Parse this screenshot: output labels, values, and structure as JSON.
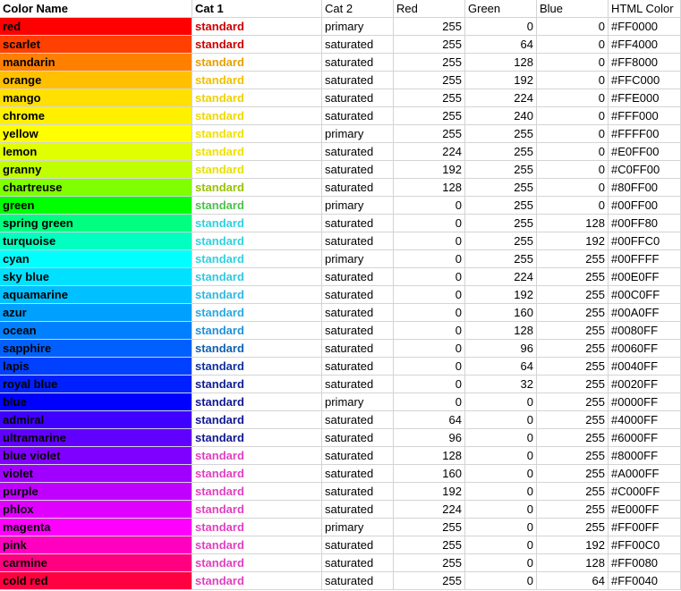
{
  "headers": [
    "Color Name",
    "Cat 1",
    "Cat 2",
    "Red",
    "Green",
    "Blue",
    "HTML Color"
  ],
  "rows": [
    {
      "name": "red",
      "cat1": "standard",
      "cat2": "primary",
      "r": 255,
      "g": 0,
      "b": 0,
      "hex": "#FF0000",
      "swatch": "#FF0000",
      "cat1_color": "#CC0000"
    },
    {
      "name": "scarlet",
      "cat1": "standard",
      "cat2": "saturated",
      "r": 255,
      "g": 64,
      "b": 0,
      "hex": "#FF4000",
      "swatch": "#FF4000",
      "cat1_color": "#CC0000"
    },
    {
      "name": "mandarin",
      "cat1": "standard",
      "cat2": "saturated",
      "r": 255,
      "g": 128,
      "b": 0,
      "hex": "#FF8000",
      "swatch": "#FF8000",
      "cat1_color": "#E6A000"
    },
    {
      "name": "orange",
      "cat1": "standard",
      "cat2": "saturated",
      "r": 255,
      "g": 192,
      "b": 0,
      "hex": "#FFC000",
      "swatch": "#FFC000",
      "cat1_color": "#F0C000"
    },
    {
      "name": "mango",
      "cat1": "standard",
      "cat2": "saturated",
      "r": 255,
      "g": 224,
      "b": 0,
      "hex": "#FFE000",
      "swatch": "#FFE000",
      "cat1_color": "#F0D000"
    },
    {
      "name": "chrome",
      "cat1": "standard",
      "cat2": "saturated",
      "r": 255,
      "g": 240,
      "b": 0,
      "hex": "#FFF000",
      "swatch": "#FFF000",
      "cat1_color": "#F0D800"
    },
    {
      "name": "yellow",
      "cat1": "standard",
      "cat2": "primary",
      "r": 255,
      "g": 255,
      "b": 0,
      "hex": "#FFFF00",
      "swatch": "#FFFF00",
      "cat1_color": "#F0E000"
    },
    {
      "name": "lemon",
      "cat1": "standard",
      "cat2": "saturated",
      "r": 224,
      "g": 255,
      "b": 0,
      "hex": "#E0FF00",
      "swatch": "#E0FF00",
      "cat1_color": "#F0E000"
    },
    {
      "name": "granny",
      "cat1": "standard",
      "cat2": "saturated",
      "r": 192,
      "g": 255,
      "b": 0,
      "hex": "#C0FF00",
      "swatch": "#C0FF00",
      "cat1_color": "#E8E000"
    },
    {
      "name": "chartreuse",
      "cat1": "standard",
      "cat2": "saturated",
      "r": 128,
      "g": 255,
      "b": 0,
      "hex": "#80FF00",
      "swatch": "#80FF00",
      "cat1_color": "#9AC200"
    },
    {
      "name": "green",
      "cat1": "standard",
      "cat2": "primary",
      "r": 0,
      "g": 255,
      "b": 0,
      "hex": "#00FF00",
      "swatch": "#00FF00",
      "cat1_color": "#4CC04C"
    },
    {
      "name": "spring green",
      "cat1": "standard",
      "cat2": "saturated",
      "r": 0,
      "g": 255,
      "b": 128,
      "hex": "#00FF80",
      "swatch": "#00FF80",
      "cat1_color": "#30D0E0"
    },
    {
      "name": "turquoise",
      "cat1": "standard",
      "cat2": "saturated",
      "r": 0,
      "g": 255,
      "b": 192,
      "hex": "#00FFC0",
      "swatch": "#00FFC0",
      "cat1_color": "#30D0E0"
    },
    {
      "name": "cyan",
      "cat1": "standard",
      "cat2": "primary",
      "r": 0,
      "g": 255,
      "b": 255,
      "hex": "#00FFFF",
      "swatch": "#00FFFF",
      "cat1_color": "#30D0E0"
    },
    {
      "name": "sky blue",
      "cat1": "standard",
      "cat2": "saturated",
      "r": 0,
      "g": 224,
      "b": 255,
      "hex": "#00E0FF",
      "swatch": "#00E0FF",
      "cat1_color": "#30C8E0"
    },
    {
      "name": "aquamarine",
      "cat1": "standard",
      "cat2": "saturated",
      "r": 0,
      "g": 192,
      "b": 255,
      "hex": "#00C0FF",
      "swatch": "#00C0FF",
      "cat1_color": "#30B8E0"
    },
    {
      "name": "azur",
      "cat1": "standard",
      "cat2": "saturated",
      "r": 0,
      "g": 160,
      "b": 255,
      "hex": "#00A0FF",
      "swatch": "#00A0FF",
      "cat1_color": "#2AA8E0"
    },
    {
      "name": "ocean",
      "cat1": "standard",
      "cat2": "saturated",
      "r": 0,
      "g": 128,
      "b": 255,
      "hex": "#0080FF",
      "swatch": "#0080FF",
      "cat1_color": "#2090D8"
    },
    {
      "name": "sapphire",
      "cat1": "standard",
      "cat2": "saturated",
      "r": 0,
      "g": 96,
      "b": 255,
      "hex": "#0060FF",
      "swatch": "#0060FF",
      "cat1_color": "#1060B0"
    },
    {
      "name": "lapis",
      "cat1": "standard",
      "cat2": "saturated",
      "r": 0,
      "g": 64,
      "b": 255,
      "hex": "#0040FF",
      "swatch": "#0040FF",
      "cat1_color": "#1030A0"
    },
    {
      "name": "royal blue",
      "cat1": "standard",
      "cat2": "saturated",
      "r": 0,
      "g": 32,
      "b": 255,
      "hex": "#0020FF",
      "swatch": "#0020FF",
      "cat1_color": "#102090"
    },
    {
      "name": "blue",
      "cat1": "standard",
      "cat2": "primary",
      "r": 0,
      "g": 0,
      "b": 255,
      "hex": "#0000FF",
      "swatch": "#0000FF",
      "cat1_color": "#101890"
    },
    {
      "name": "admiral",
      "cat1": "standard",
      "cat2": "saturated",
      "r": 64,
      "g": 0,
      "b": 255,
      "hex": "#4000FF",
      "swatch": "#4000FF",
      "cat1_color": "#101890"
    },
    {
      "name": "ultramarine",
      "cat1": "standard",
      "cat2": "saturated",
      "r": 96,
      "g": 0,
      "b": 255,
      "hex": "#6000FF",
      "swatch": "#6000FF",
      "cat1_color": "#101890"
    },
    {
      "name": "blue violet",
      "cat1": "standard",
      "cat2": "saturated",
      "r": 128,
      "g": 0,
      "b": 255,
      "hex": "#8000FF",
      "swatch": "#8000FF",
      "cat1_color": "#E040C0"
    },
    {
      "name": "violet",
      "cat1": "standard",
      "cat2": "saturated",
      "r": 160,
      "g": 0,
      "b": 255,
      "hex": "#A000FF",
      "swatch": "#A000FF",
      "cat1_color": "#E040C0"
    },
    {
      "name": "purple",
      "cat1": "standard",
      "cat2": "saturated",
      "r": 192,
      "g": 0,
      "b": 255,
      "hex": "#C000FF",
      "swatch": "#C000FF",
      "cat1_color": "#E040C0"
    },
    {
      "name": "phlox",
      "cat1": "standard",
      "cat2": "saturated",
      "r": 224,
      "g": 0,
      "b": 255,
      "hex": "#E000FF",
      "swatch": "#E000FF",
      "cat1_color": "#E040C0"
    },
    {
      "name": "magenta",
      "cat1": "standard",
      "cat2": "primary",
      "r": 255,
      "g": 0,
      "b": 255,
      "hex": "#FF00FF",
      "swatch": "#FF00FF",
      "cat1_color": "#E040C0"
    },
    {
      "name": "pink",
      "cat1": "standard",
      "cat2": "saturated",
      "r": 255,
      "g": 0,
      "b": 192,
      "hex": "#FF00C0",
      "swatch": "#FF00C0",
      "cat1_color": "#E040C0"
    },
    {
      "name": "carmine",
      "cat1": "standard",
      "cat2": "saturated",
      "r": 255,
      "g": 0,
      "b": 128,
      "hex": "#FF0080",
      "swatch": "#FF0080",
      "cat1_color": "#E040C0"
    },
    {
      "name": "cold red",
      "cat1": "standard",
      "cat2": "saturated",
      "r": 255,
      "g": 0,
      "b": 64,
      "hex": "#FF0040",
      "swatch": "#FF0040",
      "cat1_color": "#E040C0"
    }
  ]
}
